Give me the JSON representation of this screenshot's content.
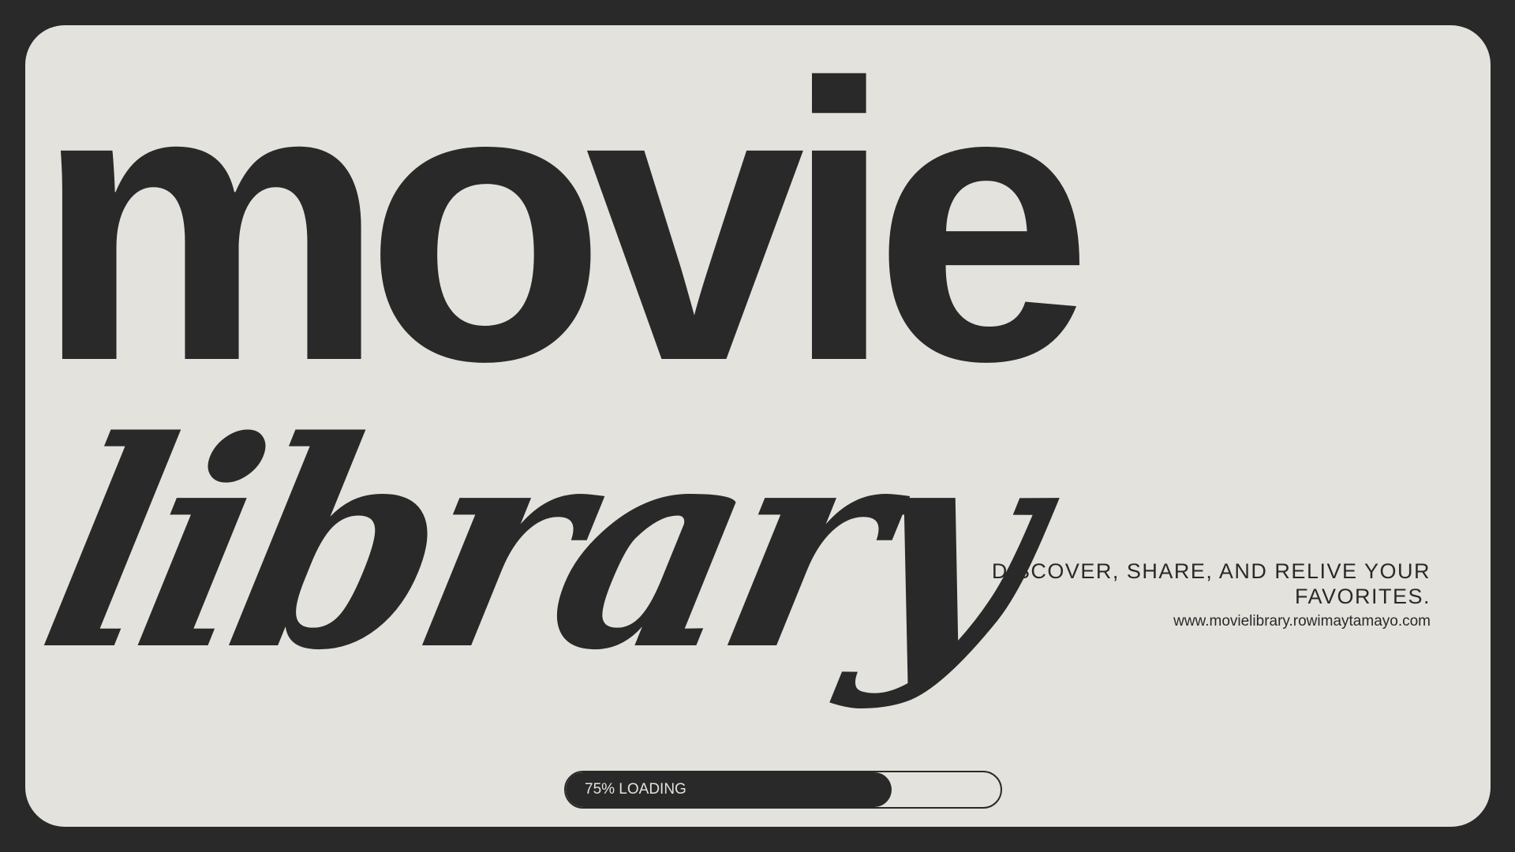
{
  "title": {
    "line1": "movie",
    "line2": "library"
  },
  "tagline": "DISCOVER, SHARE, AND RELIVE YOUR FAVORITES.",
  "website": "www.movielibrary.rowimaytamayo.com",
  "progress": {
    "percent": 75,
    "label": "75% LOADING"
  },
  "colors": {
    "background": "#292929",
    "panel": "#e3e2dd",
    "ink": "#292929"
  }
}
